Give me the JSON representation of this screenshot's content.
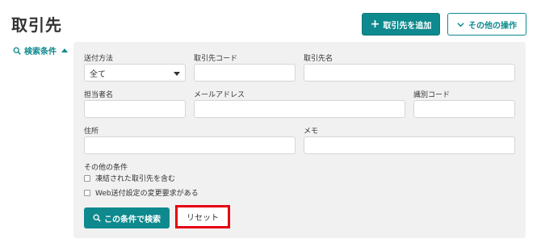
{
  "header": {
    "title": "取引先",
    "add_button_label": "取引先を追加",
    "other_actions_label": "その他の操作"
  },
  "search": {
    "toggle_label": "検索条件",
    "fields": {
      "send_method_label": "送付方法",
      "send_method_value": "全て",
      "partner_code_label": "取引先コード",
      "partner_name_label": "取引先名",
      "person_label": "担当者名",
      "email_label": "メールアドレス",
      "id_code_label": "識別コード",
      "address_label": "住所",
      "memo_label": "メモ"
    },
    "other_conditions": {
      "heading": "その他の条件",
      "include_linked_label": "凍結された取引先を含む",
      "web_change_label": "Web送付設定の変更要求がある"
    },
    "submit_label": "この条件で検索",
    "reset_label": "リセット"
  },
  "colors": {
    "accent": "#0e8a8e",
    "highlight": "#e60012",
    "panel_bg": "#f1f1f1"
  }
}
